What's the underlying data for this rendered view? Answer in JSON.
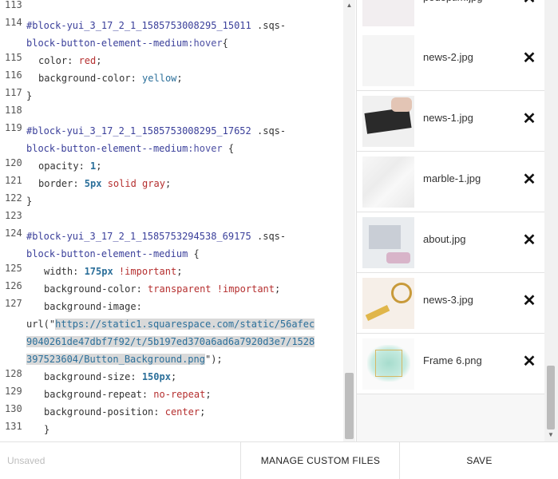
{
  "editor": {
    "lines": [
      {
        "num": "113",
        "text": ""
      },
      {
        "num": "114",
        "sel": "#block-yui_3_17_2_1_1585753008295_15011",
        "rest": " .sqs-"
      },
      {
        "num": "",
        "sel": "block-button-element--medium",
        "pseudo": ":hover",
        "brace": "{"
      },
      {
        "num": "115",
        "prop": "color: ",
        "val": "red",
        "end": ";"
      },
      {
        "num": "116",
        "prop": "background-color: ",
        "val": "yellow",
        "end": ";"
      },
      {
        "num": "117",
        "text": "}"
      },
      {
        "num": "118",
        "text": ""
      },
      {
        "num": "119",
        "sel": "#block-yui_3_17_2_1_1585753008295_17652",
        "rest": " .sqs-"
      },
      {
        "num": "",
        "sel": "block-button-element--medium",
        "pseudo": ":hover",
        "brace": " {"
      },
      {
        "num": "120",
        "prop": "opacity: ",
        "val": "1",
        "end": ";"
      },
      {
        "num": "121",
        "prop": "border: ",
        "val": "5px",
        "val2": " solid gray",
        "end": ";"
      },
      {
        "num": "122",
        "text": "}"
      },
      {
        "num": "123",
        "text": ""
      },
      {
        "num": "124",
        "sel": "#block-yui_3_17_2_1_1585753294538_69175",
        "rest": " .sqs-"
      },
      {
        "num": "",
        "sel": "block-button-element--medium",
        "brace": " {"
      },
      {
        "num": "125",
        "prop": "width: ",
        "val": "175px",
        "imp": " !important",
        "end": ";"
      },
      {
        "num": "126",
        "prop": "background-color: ",
        "val": "transparent",
        "imp": " !important",
        "end": ";"
      },
      {
        "num": "127",
        "prop": "background-image:"
      },
      {
        "num": "",
        "url1": "url(\"",
        "str": "https://static1.squarespace.com/static/56afec"
      },
      {
        "num": "",
        "str": "9040261de47dbf7f92/t/5b197ed370a6ad6a7920d3e7/1528"
      },
      {
        "num": "",
        "str": "397523604/Button_Background.png",
        "url2": "\");"
      },
      {
        "num": "128",
        "prop": "background-size: ",
        "val": "150px",
        "end": ";"
      },
      {
        "num": "129",
        "prop": "background-repeat: ",
        "val": "no-repeat",
        "end": ";"
      },
      {
        "num": "130",
        "prop": "background-position: ",
        "val": "center",
        "end": ";"
      },
      {
        "num": "131",
        "text": "}"
      }
    ]
  },
  "files": [
    {
      "name": "podoptim.jpg",
      "thumb": "pastel-objects"
    },
    {
      "name": "news-2.jpg",
      "thumb": "blank-white"
    },
    {
      "name": "news-1.jpg",
      "thumb": "laptop-keyboard"
    },
    {
      "name": "marble-1.jpg",
      "thumb": "marble"
    },
    {
      "name": "about.jpg",
      "thumb": "laptop-desk"
    },
    {
      "name": "news-3.jpg",
      "thumb": "gold-accessories"
    },
    {
      "name": "Frame 6.png",
      "thumb": "watercolor-frame"
    }
  ],
  "footer": {
    "status": "Unsaved",
    "manage_label": "MANAGE CUSTOM FILES",
    "save_label": "SAVE"
  },
  "icons": {
    "remove": "close-icon"
  }
}
